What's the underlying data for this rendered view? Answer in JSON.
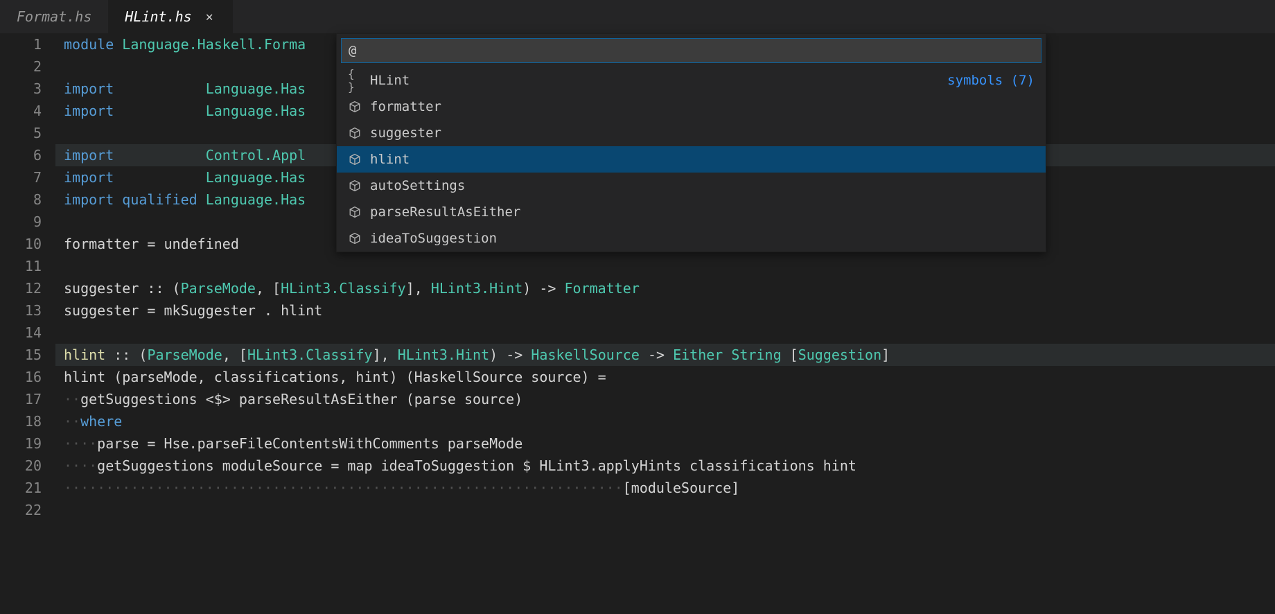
{
  "tabs": [
    {
      "label": "Format.hs",
      "active": false
    },
    {
      "label": "HLint.hs",
      "active": true
    }
  ],
  "quickopen": {
    "query": "@",
    "meta": "symbols (7)",
    "items": [
      {
        "icon": "braces",
        "label": "HLint",
        "selected": false,
        "showMeta": true
      },
      {
        "icon": "cube",
        "label": "formatter",
        "selected": false
      },
      {
        "icon": "cube",
        "label": "suggester",
        "selected": false
      },
      {
        "icon": "cube",
        "label": "hlint",
        "selected": true
      },
      {
        "icon": "cube",
        "label": "autoSettings",
        "selected": false
      },
      {
        "icon": "cube",
        "label": "parseResultAsEither",
        "selected": false
      },
      {
        "icon": "cube",
        "label": "ideaToSuggestion",
        "selected": false
      }
    ]
  },
  "lines": [
    {
      "n": 1,
      "tokens": [
        {
          "t": "module ",
          "c": "kw"
        },
        {
          "t": "Language.Haskell.Forma",
          "c": "type"
        }
      ]
    },
    {
      "n": 2,
      "tokens": []
    },
    {
      "n": 3,
      "tokens": [
        {
          "t": "import           ",
          "c": "kw"
        },
        {
          "t": "Language.Has",
          "c": "type"
        }
      ]
    },
    {
      "n": 4,
      "tokens": [
        {
          "t": "import           ",
          "c": "kw"
        },
        {
          "t": "Language.Has",
          "c": "type"
        }
      ]
    },
    {
      "n": 5,
      "tokens": []
    },
    {
      "n": 6,
      "hl": true,
      "tokens": [
        {
          "t": "import           ",
          "c": "kw"
        },
        {
          "t": "Control.Appl",
          "c": "type"
        }
      ]
    },
    {
      "n": 7,
      "tokens": [
        {
          "t": "import           ",
          "c": "kw"
        },
        {
          "t": "Language.Has",
          "c": "type"
        }
      ]
    },
    {
      "n": 8,
      "tokens": [
        {
          "t": "import ",
          "c": "kw"
        },
        {
          "t": "qualified ",
          "c": "kw"
        },
        {
          "t": "Language.Has",
          "c": "type"
        }
      ]
    },
    {
      "n": 9,
      "tokens": []
    },
    {
      "n": 10,
      "tokens": [
        {
          "t": "formatter = undefined",
          "c": "op"
        }
      ]
    },
    {
      "n": 11,
      "tokens": []
    },
    {
      "n": 12,
      "tokens": [
        {
          "t": "suggester ",
          "c": "op"
        },
        {
          "t": ":: ",
          "c": "op"
        },
        {
          "t": "(",
          "c": "punct"
        },
        {
          "t": "ParseMode",
          "c": "type"
        },
        {
          "t": ", [",
          "c": "punct"
        },
        {
          "t": "HLint3.Classify",
          "c": "type"
        },
        {
          "t": "], ",
          "c": "punct"
        },
        {
          "t": "HLint3.Hint",
          "c": "type"
        },
        {
          "t": ") -> ",
          "c": "punct"
        },
        {
          "t": "Formatter",
          "c": "type"
        }
      ]
    },
    {
      "n": 13,
      "tokens": [
        {
          "t": "suggester = mkSuggester . hlint",
          "c": "op"
        }
      ]
    },
    {
      "n": 14,
      "tokens": []
    },
    {
      "n": 15,
      "hl": true,
      "tokens": [
        {
          "t": "hlint",
          "c": "func hlword"
        },
        {
          "t": " ",
          "c": "op"
        },
        {
          "t": ":: ",
          "c": "op"
        },
        {
          "t": "(",
          "c": "punct"
        },
        {
          "t": "ParseMode",
          "c": "type"
        },
        {
          "t": ", [",
          "c": "punct"
        },
        {
          "t": "HLint3.Classify",
          "c": "type"
        },
        {
          "t": "], ",
          "c": "punct"
        },
        {
          "t": "HLint3.Hint",
          "c": "type"
        },
        {
          "t": ") -> ",
          "c": "punct"
        },
        {
          "t": "HaskellSource",
          "c": "type"
        },
        {
          "t": " -> ",
          "c": "punct"
        },
        {
          "t": "Either",
          "c": "type"
        },
        {
          "t": " ",
          "c": "punct"
        },
        {
          "t": "String",
          "c": "type"
        },
        {
          "t": " [",
          "c": "punct"
        },
        {
          "t": "Suggestion",
          "c": "type"
        },
        {
          "t": "]",
          "c": "punct"
        }
      ]
    },
    {
      "n": 16,
      "tokens": [
        {
          "t": "hlint (parseMode, classifications, hint) (HaskellSource source) =",
          "c": "op"
        }
      ]
    },
    {
      "n": 17,
      "tokens": [
        {
          "t": "··",
          "c": "ws"
        },
        {
          "t": "getSuggestions <$> parseResultAsEither (parse source)",
          "c": "op"
        }
      ]
    },
    {
      "n": 18,
      "tokens": [
        {
          "t": "··",
          "c": "ws"
        },
        {
          "t": "where",
          "c": "kw"
        }
      ]
    },
    {
      "n": 19,
      "tokens": [
        {
          "t": "····",
          "c": "ws"
        },
        {
          "t": "parse = Hse.parseFileContentsWithComments parseMode",
          "c": "op"
        }
      ]
    },
    {
      "n": 20,
      "tokens": [
        {
          "t": "····",
          "c": "ws"
        },
        {
          "t": "getSuggestions moduleSource = map ideaToSuggestion $ HLint3.applyHints classifications hint",
          "c": "op"
        }
      ]
    },
    {
      "n": 21,
      "tokens": [
        {
          "t": "···································································",
          "c": "ws"
        },
        {
          "t": "[moduleSource]",
          "c": "op"
        }
      ]
    },
    {
      "n": 22,
      "tokens": []
    }
  ]
}
